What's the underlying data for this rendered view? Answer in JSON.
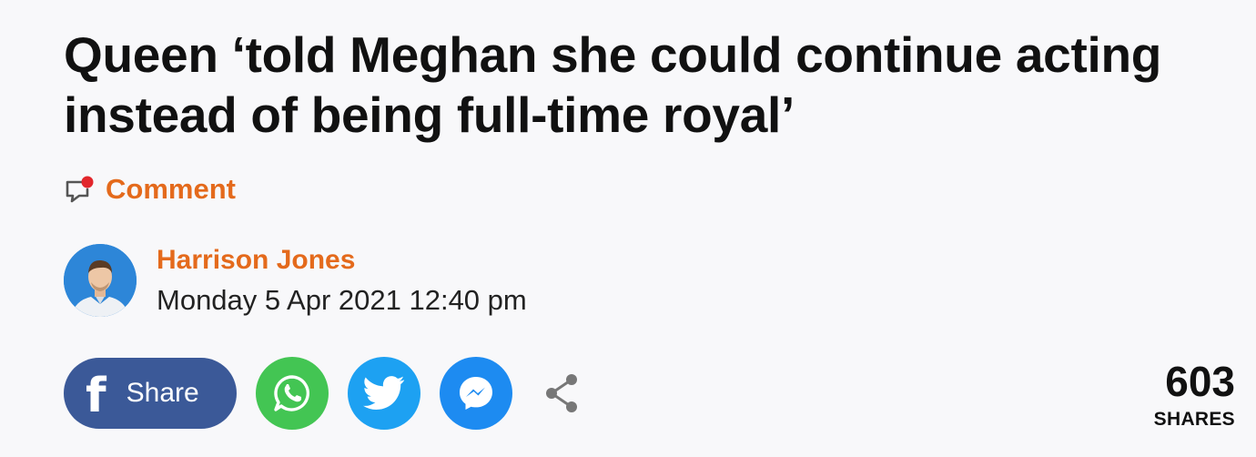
{
  "article": {
    "headline": "Queen ‘told Meghan she could continue acting instead of being full-time royal’",
    "comment_label": "Comment",
    "author_name": "Harrison Jones",
    "published": "Monday 5 Apr 2021 12:40 pm"
  },
  "share": {
    "facebook_label": "Share",
    "facebook_glyph": "f",
    "buttons": [
      {
        "icon": "whatsapp-icon",
        "color": "#43c553"
      },
      {
        "icon": "twitter-icon",
        "color": "#1da1f2"
      },
      {
        "icon": "messenger-icon",
        "color": "#1d8bf1"
      },
      {
        "icon": "share-icon",
        "color": "#777777"
      }
    ],
    "count": "603",
    "count_label": "SHARES"
  },
  "colors": {
    "accent": "#e46a1c",
    "facebook": "#3b5998",
    "text": "#111111",
    "background": "#f8f8fa"
  }
}
